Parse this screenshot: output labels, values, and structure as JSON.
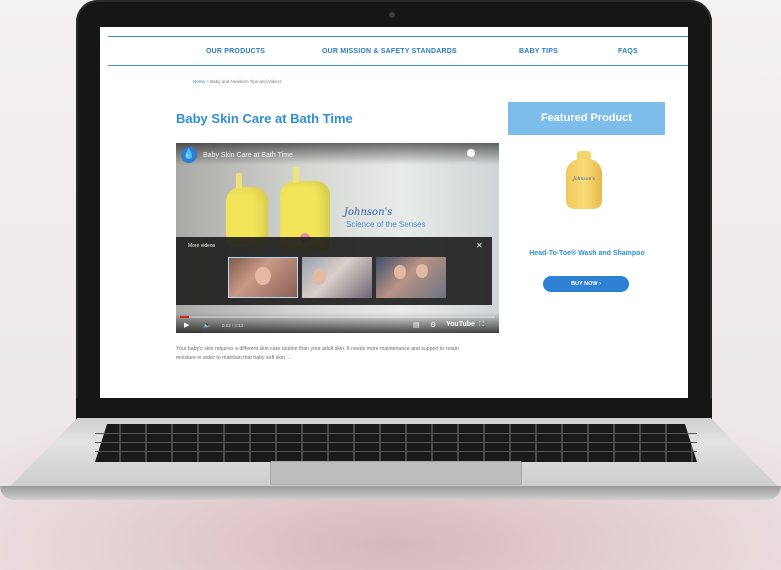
{
  "nav": {
    "items": [
      "OUR PRODUCTS",
      "OUR MISSION & SAFETY STANDARDS",
      "BABY TIPS",
      "FAQS"
    ]
  },
  "breadcrumb": {
    "home": "Home",
    "separator": ">",
    "current": "Baby and Newborn Tips and Videos"
  },
  "article": {
    "title": "Baby Skin Care at Bath Time",
    "description": "Your baby's skin requires a different skin care routine than your adult skin. It needs more maintenance and support to retain moisture in order to maintain that baby soft skin. ..."
  },
  "video": {
    "title": "Baby Skin Care at Bath Time",
    "share_label": "Watch later",
    "brand": "Johnson's",
    "brand_tagline": "Science of the Senses",
    "more_videos_label": "More videos",
    "close_symbol": "✕",
    "time": "0:02 / 2:13",
    "progress": 0.03,
    "platform_label": "YouTube"
  },
  "sidebar": {
    "featured_title": "Featured Product",
    "product_label": "Johnson's",
    "product_name": "Head-To-Toe® Wash and Shampoo",
    "buy_label": "BUY NOW  ›"
  },
  "colors": {
    "accent": "#2f8fd6",
    "featured_bg": "#7dbde9",
    "button": "#2f7fd3"
  }
}
